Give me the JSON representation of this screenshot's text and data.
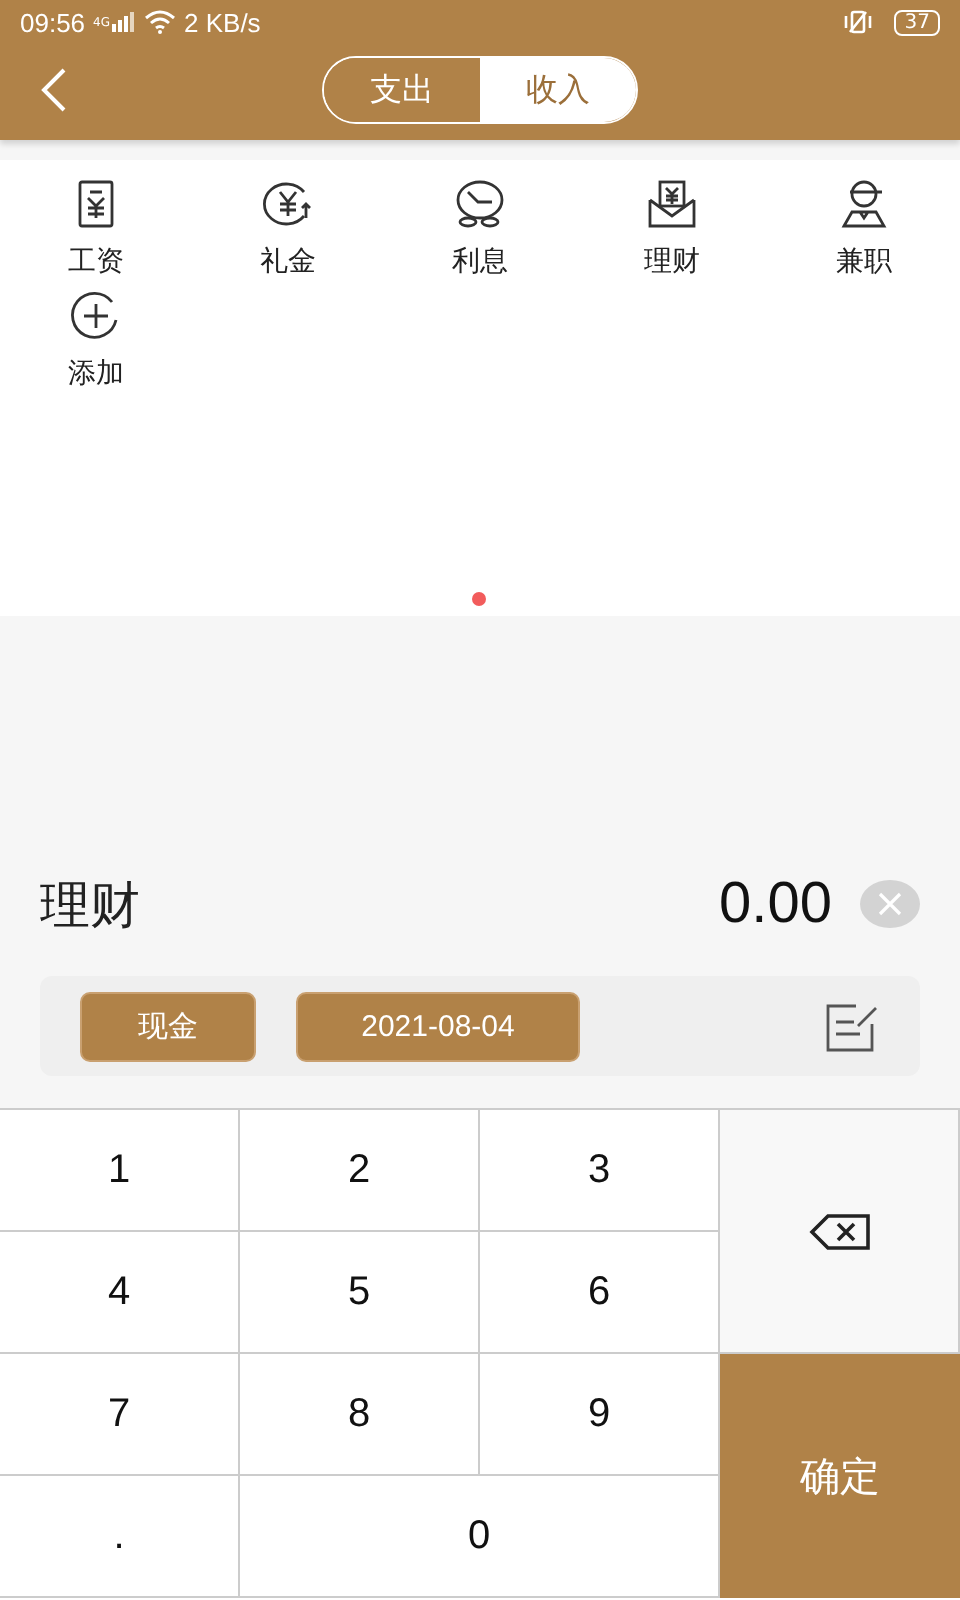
{
  "status_bar": {
    "time": "09:56",
    "network": "4G",
    "speed": "2 KB/s",
    "battery": "37"
  },
  "header": {
    "tabs": [
      {
        "label": "支出",
        "selected": false
      },
      {
        "label": "收入",
        "selected": true
      }
    ]
  },
  "categories": [
    {
      "label": "工资",
      "kind": "salary"
    },
    {
      "label": "礼金",
      "kind": "gift"
    },
    {
      "label": "利息",
      "kind": "interest"
    },
    {
      "label": "理财",
      "kind": "finance"
    },
    {
      "label": "兼职",
      "kind": "parttime"
    },
    {
      "label": "添加",
      "kind": "add"
    }
  ],
  "entry": {
    "category": "理财",
    "amount": "0.00",
    "account": "现金",
    "date": "2021-08-04"
  },
  "keypad": [
    {
      "kind": "digit",
      "label": "1"
    },
    {
      "kind": "digit",
      "label": "2"
    },
    {
      "kind": "digit",
      "label": "3"
    },
    {
      "kind": "backspace"
    },
    {
      "kind": "digit",
      "label": "4"
    },
    {
      "kind": "digit",
      "label": "5"
    },
    {
      "kind": "digit",
      "label": "6"
    },
    {
      "kind": "digit",
      "label": "7"
    },
    {
      "kind": "digit",
      "label": "8"
    },
    {
      "kind": "digit",
      "label": "9"
    },
    {
      "kind": "confirm",
      "label": "确定"
    },
    {
      "kind": "digit",
      "label": "."
    },
    {
      "kind": "zero",
      "label": "0"
    }
  ]
}
